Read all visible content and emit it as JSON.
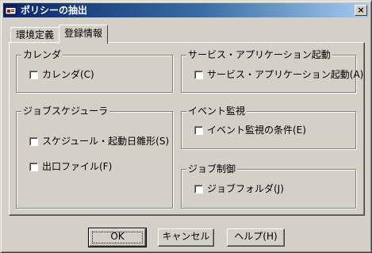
{
  "window": {
    "title": "ポリシーの抽出",
    "close_label": "×"
  },
  "tabs": [
    {
      "label": "環境定義"
    },
    {
      "label": "登録情報"
    }
  ],
  "groups": {
    "calendar": {
      "title": "カレンダ",
      "checkbox": "カレンダ(C)"
    },
    "service": {
      "title": "サービス・アプリケーション起動",
      "checkbox": "サービス・アプリケーション起動(A)"
    },
    "scheduler": {
      "title": "ジョブスケジューラ",
      "checkbox1": "スケジュール・起動日雛形(S)",
      "checkbox2": "出口ファイル(F)"
    },
    "event": {
      "title": "イベント監視",
      "checkbox": "イベント監視の条件(E)"
    },
    "job": {
      "title": "ジョブ制御",
      "checkbox": "ジョブフォルダ(J)"
    }
  },
  "buttons": {
    "ok": "OK",
    "cancel": "キャンセル",
    "help": "ヘルプ(H)"
  },
  "colors": {
    "face": "#d4d0c8",
    "title_start": "#0a246a",
    "title_end": "#a6caf0"
  }
}
